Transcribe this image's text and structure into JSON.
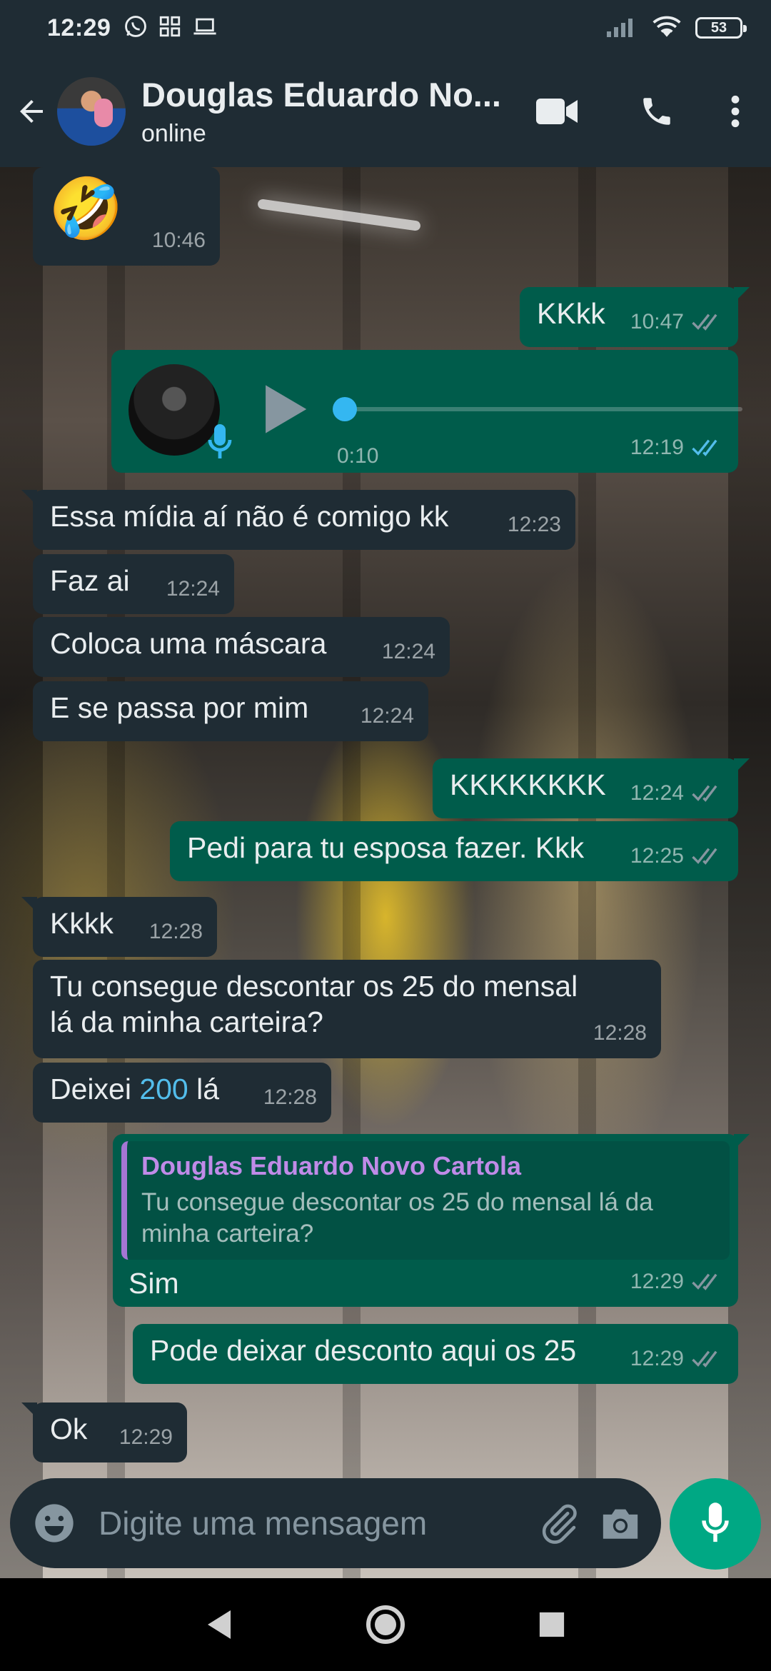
{
  "status_bar": {
    "time": "12:29",
    "battery": "53"
  },
  "header": {
    "contact_name": "Douglas Eduardo No...",
    "presence": "online"
  },
  "messages": [
    {
      "dir": "in",
      "text": "🤣",
      "time": "10:46"
    },
    {
      "dir": "out",
      "text": "KKkk",
      "time": "10:47",
      "status": "read"
    },
    {
      "dir": "out",
      "type": "voice",
      "duration": "0:10",
      "time": "12:19",
      "status": "read"
    },
    {
      "dir": "in",
      "text": "Essa mídia aí não é comigo kk",
      "time": "12:23"
    },
    {
      "dir": "in",
      "text": "Faz ai",
      "time": "12:24"
    },
    {
      "dir": "in",
      "text": "Coloca uma máscara",
      "time": "12:24"
    },
    {
      "dir": "in",
      "text": "E se passa por mim",
      "time": "12:24"
    },
    {
      "dir": "out",
      "text": "KKKKKKKK",
      "time": "12:24",
      "status": "read"
    },
    {
      "dir": "out",
      "text": "Pedi para tu esposa fazer. Kkk",
      "time": "12:25",
      "status": "read"
    },
    {
      "dir": "in",
      "text": "Kkkk",
      "time": "12:28"
    },
    {
      "dir": "in",
      "text_line1": "Tu consegue descontar os 25 do mensal",
      "text_line2": "lá da minha carteira?",
      "time": "12:28"
    },
    {
      "dir": "in",
      "text_pre": "Deixei ",
      "text_link": "200",
      "text_post": " lá",
      "time": "12:28"
    },
    {
      "dir": "out",
      "type": "reply",
      "quote_author": "Douglas Eduardo Novo Cartola",
      "quote_text": "Tu consegue descontar os 25 do mensal lá da minha carteira?",
      "text": "Sim",
      "time": "12:29",
      "status": "read"
    },
    {
      "dir": "out",
      "text": "Pode deixar desconto aqui os 25",
      "time": "12:29",
      "status": "read"
    },
    {
      "dir": "in",
      "text": "Ok",
      "time": "12:29"
    }
  ],
  "composer": {
    "placeholder": "Digite uma mensagem"
  },
  "colors": {
    "header_bg": "#1f2c34",
    "incoming_bubble": "#1f2c34",
    "outgoing_bubble": "#005c4b",
    "accent": "#00a884",
    "read_ticks": "#53bdeb"
  }
}
